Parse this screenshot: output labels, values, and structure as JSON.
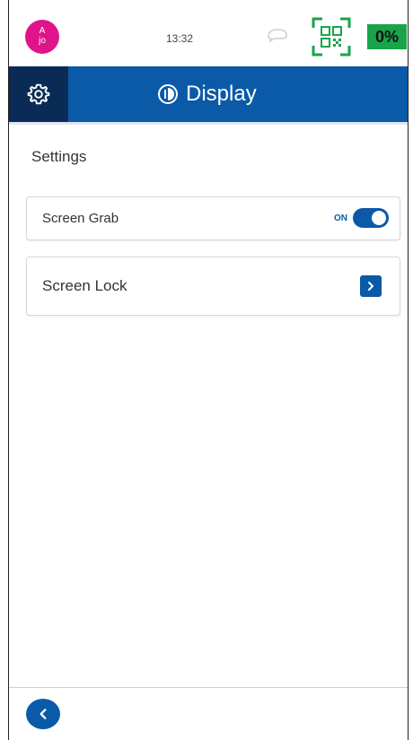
{
  "status_bar": {
    "avatar_text_top": "A",
    "avatar_text_bottom": "jo",
    "time": "13:32",
    "battery": "0%",
    "icons": [
      "cast-icon",
      "qr-scan-icon"
    ]
  },
  "header": {
    "title": "Display",
    "settings_icon": "gear-icon",
    "title_icon": "display-icon"
  },
  "section_label": "Settings",
  "items": [
    {
      "label": "Screen Grab",
      "toggle_label": "ON",
      "toggle_state": true
    },
    {
      "label": "Screen Lock",
      "action_icon": "chevron-right-icon"
    }
  ],
  "footer": {
    "back_icon": "chevron-left-icon"
  },
  "colors": {
    "primary": "#0a5aa8",
    "header_dark": "#0a2b55",
    "avatar": "#e0148a",
    "battery": "#1aa44a",
    "qr_green": "#1aa44a"
  }
}
